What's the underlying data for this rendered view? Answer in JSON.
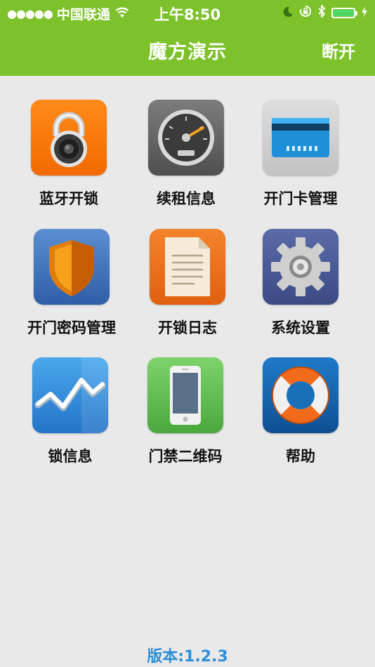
{
  "status_bar": {
    "signal_dots": "●●●●●",
    "carrier": "中国联通",
    "time": "上午8:50",
    "wifi_icon": "wifi-icon",
    "moon_icon": "moon-icon",
    "rotation_lock_icon": "rotation-lock-icon",
    "bluetooth_icon": "bluetooth-icon",
    "battery_icon": "battery-icon",
    "charging_icon": "charging-icon"
  },
  "header": {
    "title": "魔方演示",
    "disconnect_label": "断开",
    "background": "#7dc12b"
  },
  "menu": {
    "items": [
      {
        "label": "蓝牙开锁",
        "icon": "padlock-icon"
      },
      {
        "label": "续租信息",
        "icon": "speedometer-icon"
      },
      {
        "label": "开门卡管理",
        "icon": "card-icon"
      },
      {
        "label": "开门密码管理",
        "icon": "shield-icon"
      },
      {
        "label": "开锁日志",
        "icon": "document-icon"
      },
      {
        "label": "系统设置",
        "icon": "gear-icon"
      },
      {
        "label": "锁信息",
        "icon": "line-chart-icon"
      },
      {
        "label": "门禁二维码",
        "icon": "phone-icon"
      },
      {
        "label": "帮助",
        "icon": "lifebuoy-icon"
      }
    ]
  },
  "footer": {
    "version": "版本:1.2.3"
  }
}
